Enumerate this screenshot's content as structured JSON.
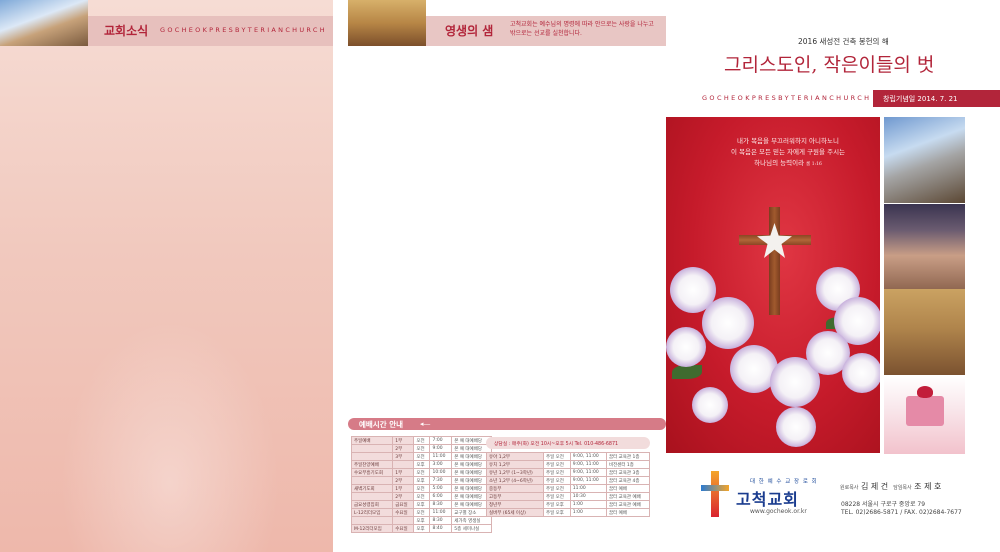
{
  "panel1": {
    "title": "교회소식",
    "subtitle": "GOCHEOKPRESBYTERIANCHURCH"
  },
  "panel2": {
    "title": "영생의 샘",
    "body": "고척교회는 예수님의 명령에 따라 안으로는 사랑을 나누고 밖으로는 선교를 실천합니다.",
    "schedule_label": "예배시간 안내",
    "notice": "상담실 : 매주(화) 오전 10시~오후 5시  Tel. 010-486-6871",
    "left_rows": [
      [
        "주일예배",
        "1부",
        "오전",
        "7:00",
        "본 예 대예배당"
      ],
      [
        "",
        "2부",
        "오전",
        "9:00",
        "본 예 대예배당"
      ],
      [
        "",
        "3부",
        "오전",
        "11:00",
        "본 예 대예배당"
      ],
      [
        "주일찬양예배",
        "",
        "오후",
        "3:00",
        "본 예 대예배당"
      ],
      [
        "수요부흥기도회",
        "1부",
        "오전",
        "10:00",
        "본 예 대예배당"
      ],
      [
        "",
        "2부",
        "오후",
        "7:30",
        "본 예 대예배당"
      ],
      [
        "새벽기도회",
        "1부",
        "오전",
        "5:00",
        "본 예 대예배당"
      ],
      [
        "",
        "2부",
        "오전",
        "6:00",
        "본 예 대예배당"
      ],
      [
        "금요성령집회",
        "금요일",
        "오후",
        "8:30",
        "본 예 대예배당"
      ],
      [
        "L-12리더모임",
        "수요일",
        "오전",
        "11:00",
        "교구별 장소"
      ],
      [
        "",
        "",
        "오후",
        "8:30",
        "세가족 영생실"
      ],
      [
        "M-12리더모임",
        "수요일",
        "오후",
        "8:40",
        "5층 세미나실"
      ]
    ],
    "right_rows": [
      [
        "유아 1,2부",
        "주일 오전",
        "9:00, 11:00",
        "꿈터 교육관 1층"
      ],
      [
        "유치 1,2부",
        "주일 오전",
        "9:00, 11:00",
        "비전센터 1층"
      ],
      [
        "유년 1,2부 (1~3학년)",
        "주일 오전",
        "9:00, 11:00",
        "꿈터 교육관 3층"
      ],
      [
        "소년 1,2부 (4~6학년)",
        "주일 오전",
        "9:00, 11:00",
        "꿈터 교육관 4층"
      ],
      [
        "중등부",
        "주일 오전",
        "11:00",
        "꿈터 예배"
      ],
      [
        "고등부",
        "주일 오전",
        "10:30",
        "꿈터 교육관 예배"
      ],
      [
        "청년부",
        "주일 오후",
        "1:00",
        "꿈터 교육관 예배"
      ],
      [
        "실버부 (65세 이상)",
        "주일 오후",
        "1:00",
        "꿈터 예배"
      ]
    ]
  },
  "panel3": {
    "tagline": "2016 새성전 건축 봉헌의 해",
    "headline": "그리스도인, 작은이들의 벗",
    "eng": "GOCHEOKPRESBYTERIANCHURCH",
    "date": "창립기념일 2014. 7. 21",
    "verse_lines": [
      "내가 복음을 부끄러워하지 아니하노니",
      "이 복음은 모든 믿는 자에게 구원을 주시는",
      "하나님의 능력이라"
    ],
    "verse_ref": "롬 1:16",
    "logo_top": "대 한 예 수 교 장 로 회",
    "logo_name": "고척교회",
    "logo_url": "www.gocheok.or.kr",
    "pastor_emeritus_label": "원로목사",
    "pastor_emeritus": "김 제 건",
    "pastor_label": "담임목사",
    "pastor": "조 제 호",
    "address": "08228 서울시 구로구 중앙로 79",
    "phone": "TEL. 02)2686-5871 / FAX. 02)2684-7677"
  }
}
